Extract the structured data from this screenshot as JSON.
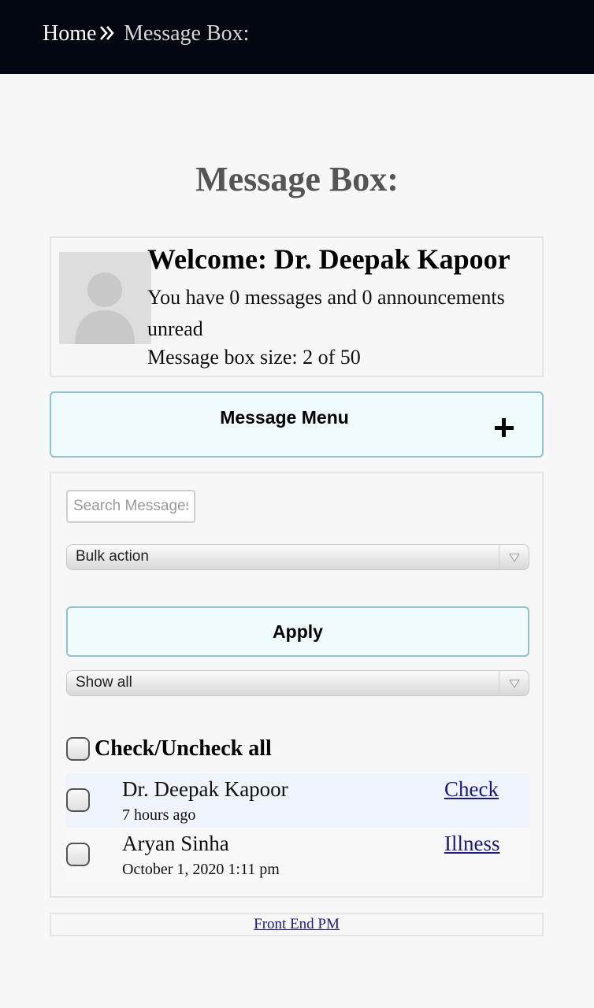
{
  "breadcrumb": {
    "home_label": "Home",
    "separator_icon": "double-chevron-right-icon",
    "current_label": "Message Box:"
  },
  "page": {
    "title": "Message Box:"
  },
  "welcome": {
    "title": "Welcome: Dr. Deepak Kapoor",
    "unread_text": "You have 0 messages and 0 announcements unread",
    "box_size_text": "Message box size: 2 of 50",
    "avatar_icon": "default-user-avatar-icon"
  },
  "menu": {
    "label": "Message Menu",
    "toggle_icon": "plus-icon"
  },
  "controls": {
    "search_placeholder": "Search Messages",
    "bulk_action_selected": "Bulk action",
    "apply_label": "Apply",
    "filter_selected": "Show all",
    "check_all_label": "Check/Uncheck all"
  },
  "messages": [
    {
      "sender": "Dr. Deepak Kapoor",
      "time": "7 hours ago",
      "subject": "Check"
    },
    {
      "sender": "Aryan Sinha",
      "time": "October 1, 2020 1:11 pm",
      "subject": "Illness"
    }
  ],
  "footer": {
    "link_label": "Front End PM"
  },
  "colors": {
    "header_bg": "#030712",
    "accent_border": "#8fc3cf",
    "accent_bg": "#effbfd",
    "link": "#1a1a80"
  }
}
